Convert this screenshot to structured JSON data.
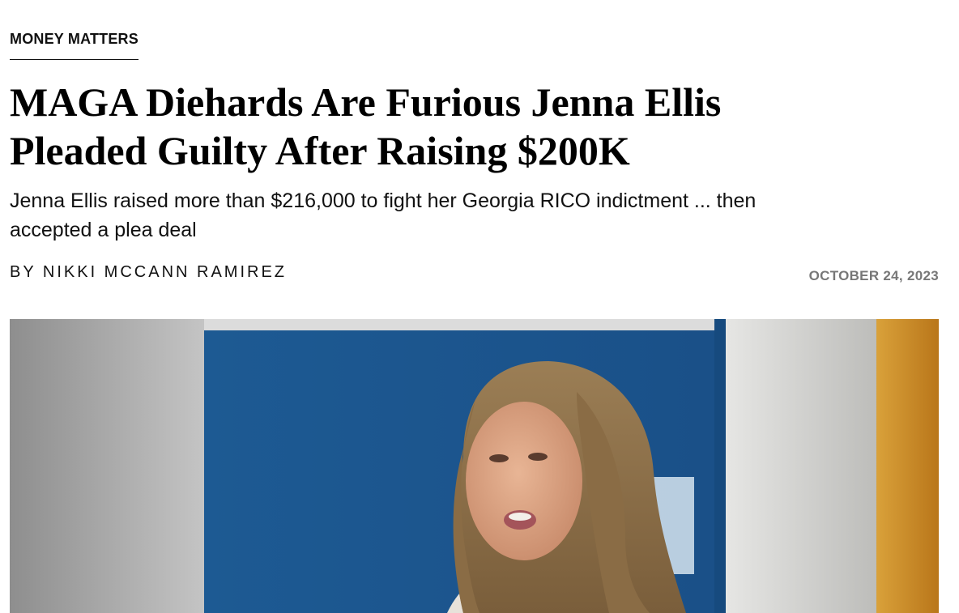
{
  "article": {
    "section": "MONEY MATTERS",
    "headline": "MAGA Diehards Are Furious Jenna Ellis Pleaded Guilty After Raising $200K",
    "dek": "Jenna Ellis raised more than $216,000 to fight her Georgia RICO indictment ... then accepted a plea deal",
    "byline_prefix": "BY",
    "author": "NIKKI MCCANN RAMIREZ",
    "date": "OCTOBER 24, 2023"
  },
  "colors": {
    "text": "#111111",
    "muted": "#777777",
    "wall_blue": "#1d5b94",
    "wood": "#c9891f"
  }
}
